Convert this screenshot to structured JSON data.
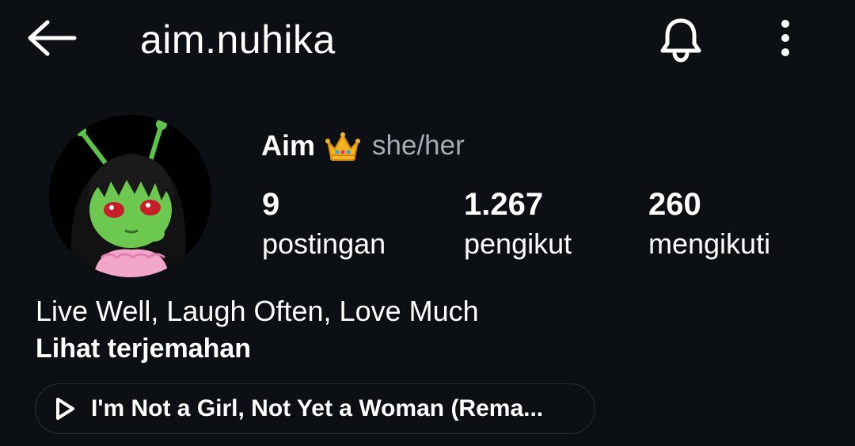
{
  "header": {
    "username": "aim.nuhika",
    "back_icon": "arrow-left-icon",
    "bell_icon": "bell-icon",
    "more_icon": "more-vertical-icon"
  },
  "profile": {
    "display_name": "Aim",
    "name_emoji": "crown-emoji",
    "pronouns": "she/her",
    "stats": {
      "posts": {
        "value": "9",
        "label": "postingan"
      },
      "followers": {
        "value": "1.267",
        "label": "pengikut"
      },
      "following": {
        "value": "260",
        "label": "mengikuti"
      }
    },
    "bio": "Live Well, Laugh Often, Love Much",
    "translate_label": "Lihat terjemahan",
    "music": {
      "icon": "play-icon",
      "title": "I'm Not a Girl, Not Yet a Woman (Rema..."
    }
  },
  "colors": {
    "background": "#0c0f14",
    "text": "#ffffff",
    "muted": "#a8acb3",
    "pill_border": "#2b2f36"
  }
}
